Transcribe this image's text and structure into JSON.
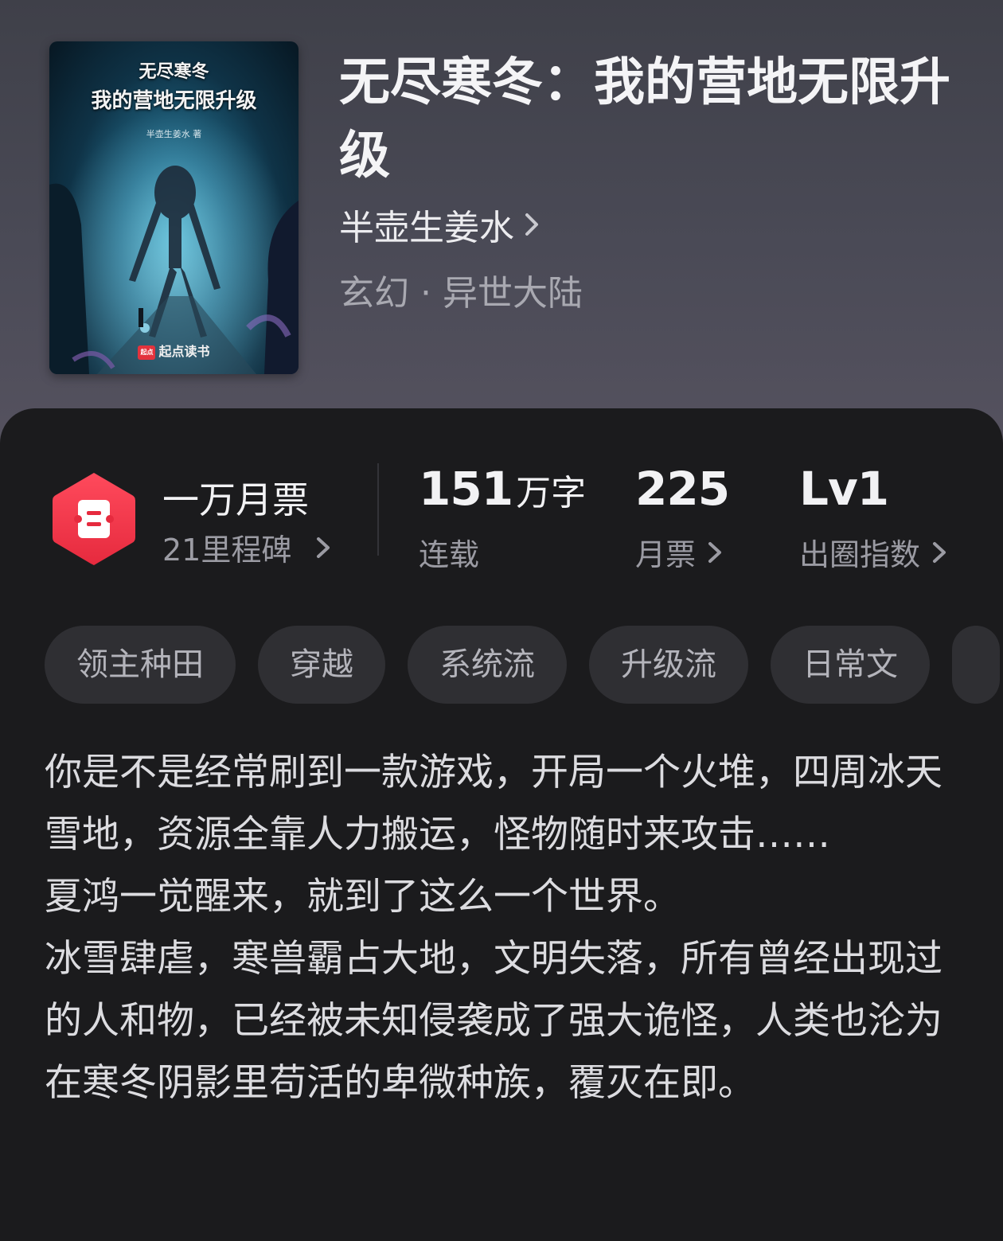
{
  "cover": {
    "title_line1": "无尽寒冬",
    "title_line2": "我的营地无限升级",
    "author": "半壶生姜水 著",
    "brand": "起点读书",
    "brand_logo": "起点"
  },
  "book": {
    "title": "无尽寒冬：我的营地无限升级",
    "author": "半壶生姜水",
    "genre": "玄幻 · 异世大陆"
  },
  "stats": {
    "milestone": {
      "title": "一万月票",
      "sub": "21里程碑"
    },
    "words": {
      "number": "151",
      "unit": "万字",
      "label": "连载"
    },
    "votes": {
      "value": "225",
      "label": "月票"
    },
    "index": {
      "value": "Lv1",
      "label": "出圈指数"
    }
  },
  "tags": [
    "领主种田",
    "穿越",
    "系统流",
    "升级流",
    "日常文"
  ],
  "description": [
    "你是不是经常刷到一款游戏，开局一个火堆，四周冰天雪地，资源全靠人力搬运，怪物随时来攻击……",
    "夏鸿一觉醒来，就到了这么一个世界。",
    "冰雪肆虐，寒兽霸占大地，文明失落，所有曾经出现过的人和物，已经被未知侵袭成了强大诡怪，人类也沦为在寒冬阴影里苟活的卑微种族，覆灭在即。"
  ],
  "colors": {
    "accent_red": "#f0344a",
    "panel_bg": "#1b1b1d",
    "tag_bg": "#2f2f33"
  },
  "icons": [
    "ticket-icon",
    "chevron-right-icon"
  ]
}
